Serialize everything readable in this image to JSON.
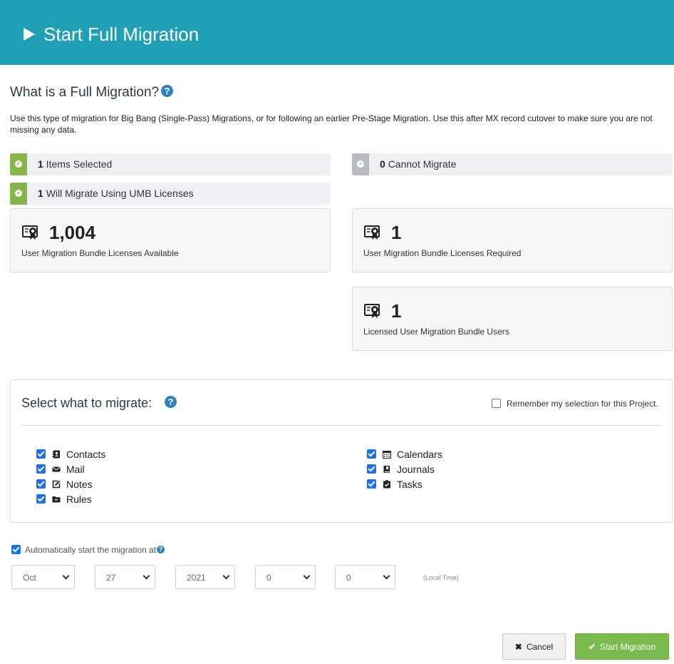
{
  "header": {
    "title": "Start Full Migration",
    "icon": "play-icon"
  },
  "intro": {
    "title": "What is a Full Migration?",
    "help": "?",
    "description": "Use this type of migration for Big Bang (Single-Pass) Migrations, or for following an earlier Pre-Stage Migration. Use this after MX record cutover to make sure you are not missing any data."
  },
  "status": {
    "selected": {
      "count": "1",
      "label": "Items Selected"
    },
    "will_migrate": {
      "count": "1",
      "label": "Will Migrate Using UMB Licenses"
    },
    "cannot": {
      "count": "0",
      "label": "Cannot Migrate"
    }
  },
  "cards": {
    "available": {
      "value": "1,004",
      "label": "User Migration Bundle Licenses Available"
    },
    "required": {
      "value": "1",
      "label": "User Migration Bundle Licenses Required"
    },
    "licensed_users": {
      "value": "1",
      "label": "Licensed User Migration Bundle Users"
    }
  },
  "migrate": {
    "title": "Select what to migrate:",
    "help": "?",
    "remember_label": "Remember my selection for this Project.",
    "left": [
      {
        "label": "Contacts",
        "icon": "address-book-icon",
        "checked": true
      },
      {
        "label": "Mail",
        "icon": "envelope-icon",
        "checked": true
      },
      {
        "label": "Notes",
        "icon": "edit-note-icon",
        "checked": true
      },
      {
        "label": "Rules",
        "icon": "archive-box-icon",
        "checked": true
      }
    ],
    "right": [
      {
        "label": "Calendars",
        "icon": "calendar-icon",
        "checked": true
      },
      {
        "label": "Journals",
        "icon": "book-icon",
        "checked": true
      },
      {
        "label": "Tasks",
        "icon": "clipboard-check-icon",
        "checked": true
      }
    ]
  },
  "schedule": {
    "auto_label": "Automatically start the migration at",
    "help": "?",
    "month": "Oct",
    "day": "27",
    "year": "2021",
    "hour": "0",
    "minute": "0",
    "timezone_note": "(Local Time)"
  },
  "buttons": {
    "cancel": "Cancel",
    "start": "Start Migration"
  },
  "colors": {
    "header": "#1fa0b4",
    "success": "#86b54a",
    "accent": "#2f7fc1",
    "start_button": "#7cbb4f"
  }
}
